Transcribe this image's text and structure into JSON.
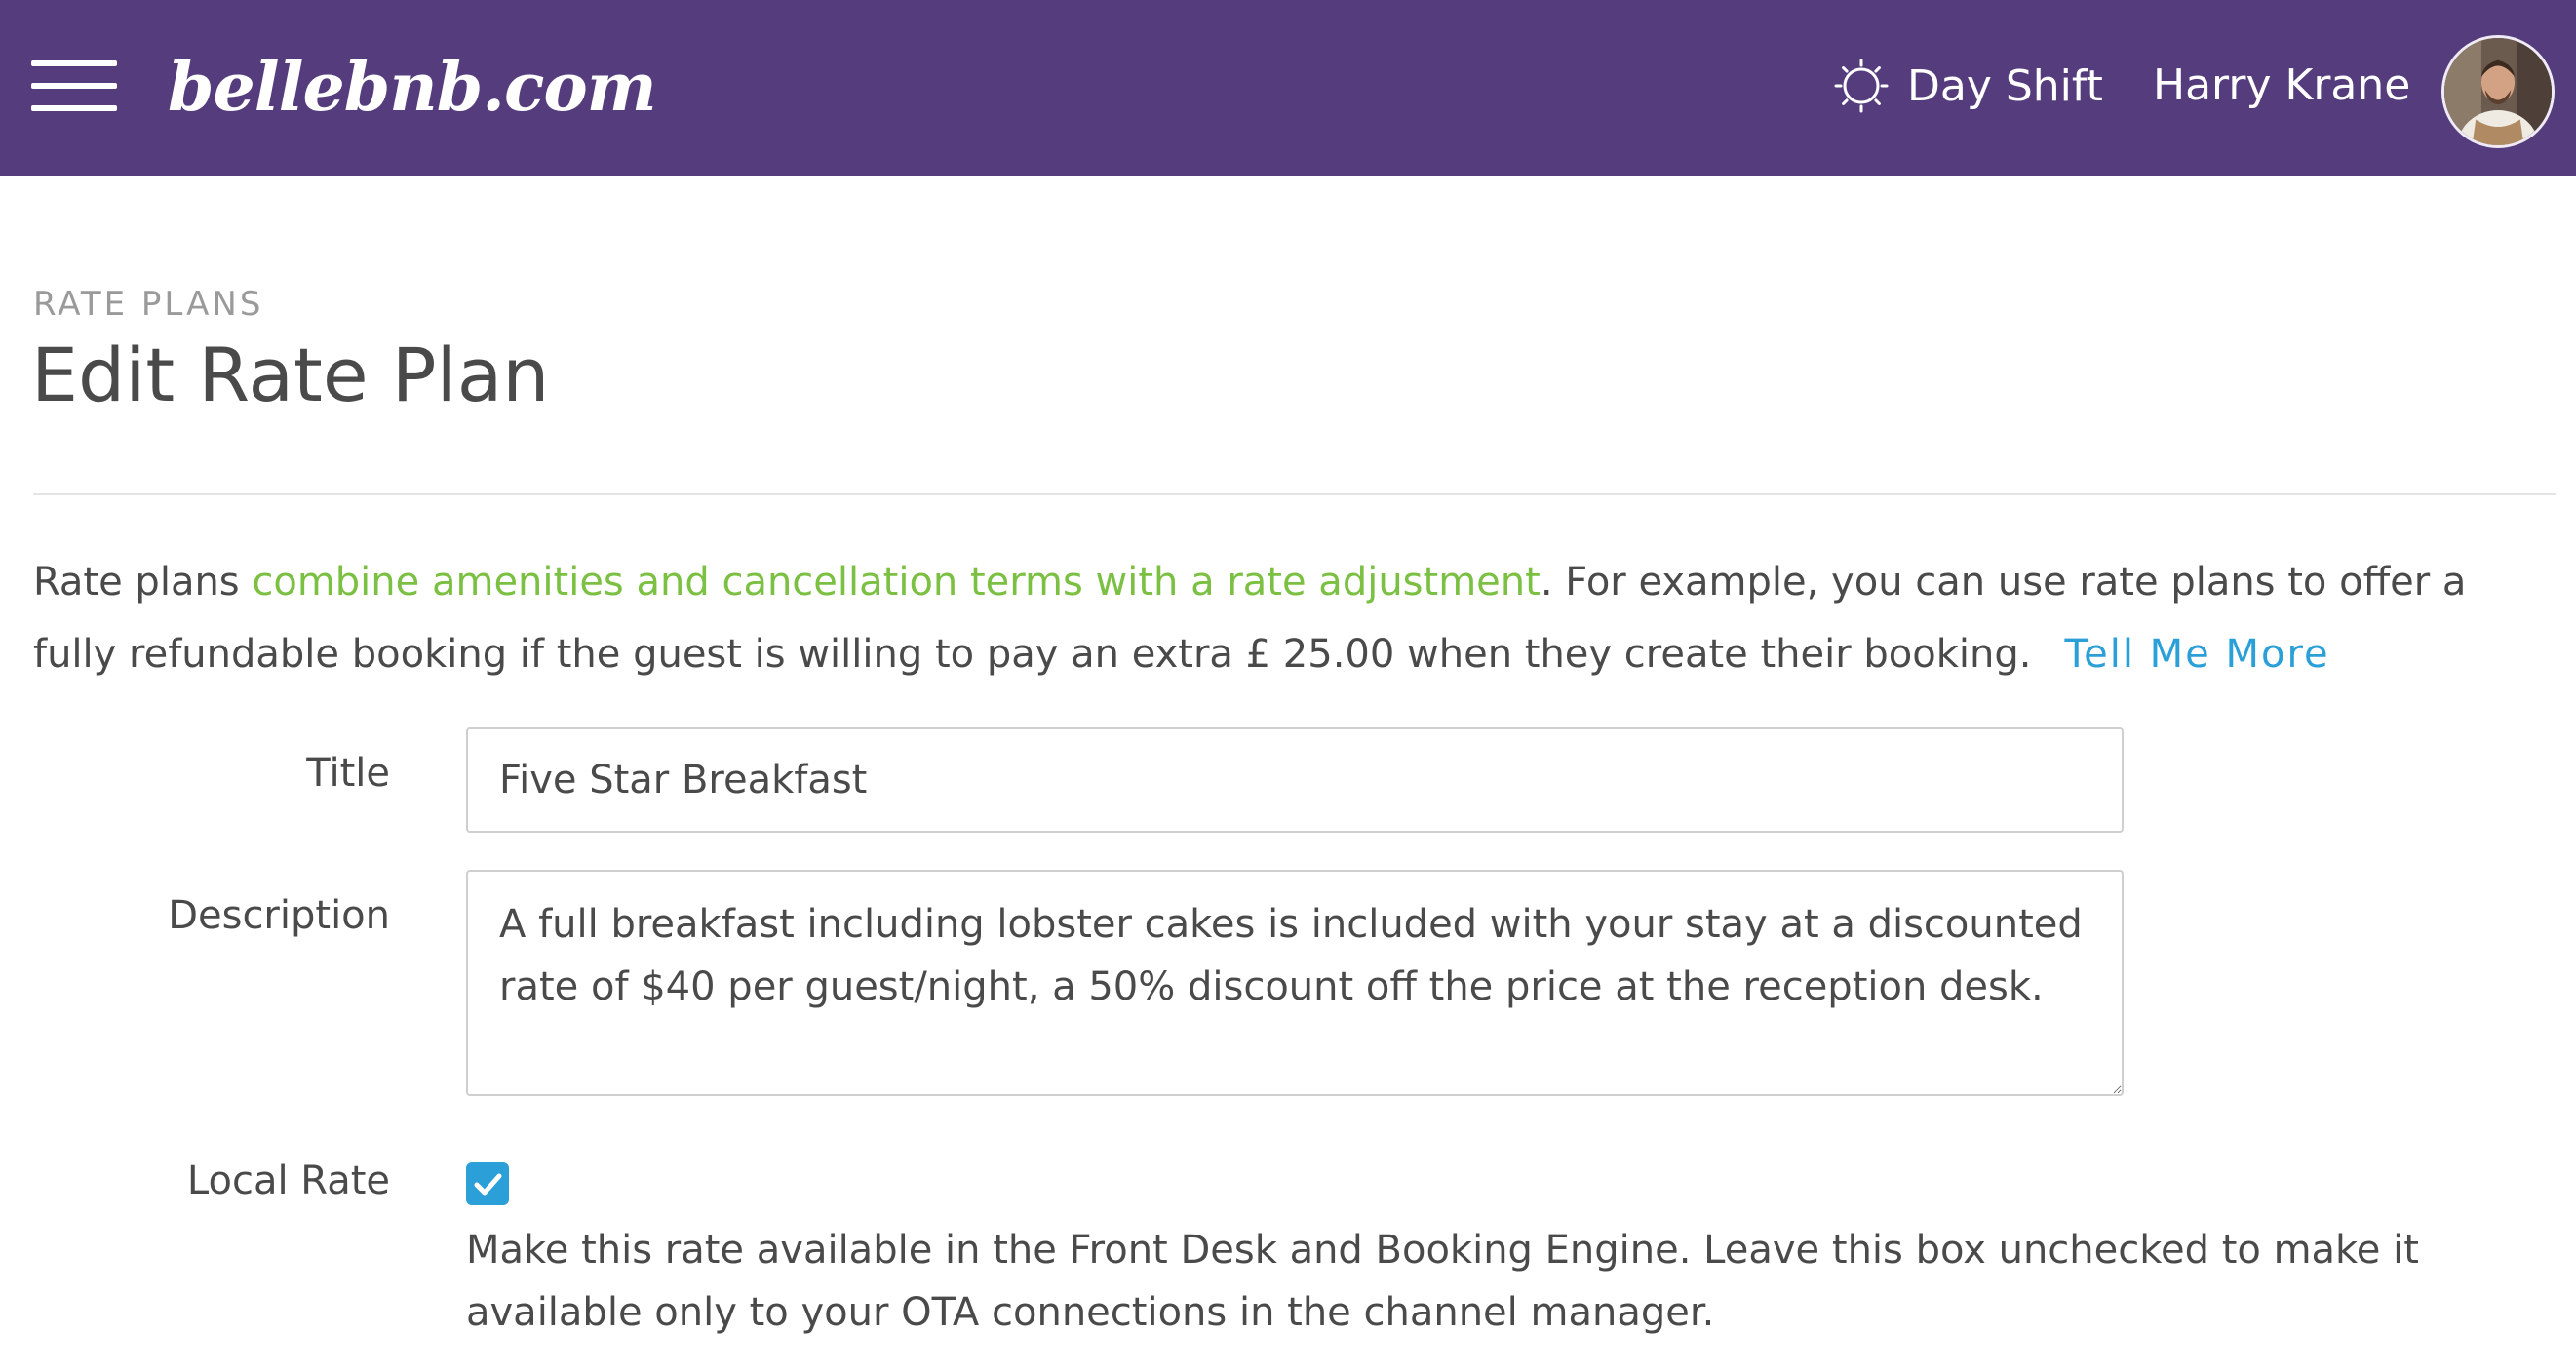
{
  "header": {
    "brand": "bellebnb.com",
    "shift_label": "Day Shift",
    "user_name": "Harry Krane"
  },
  "page": {
    "eyebrow": "RATE PLANS",
    "title": "Edit Rate Plan"
  },
  "intro": {
    "text_before": "Rate plans ",
    "highlight": "combine amenities and cancellation terms with a rate adjustment",
    "text_after": ". For example, you can use rate plans to offer a fully refundable booking if the guest is willing to pay an extra £ 25.00 when they create their booking.",
    "link_label": "Tell Me More"
  },
  "form": {
    "title_label": "Title",
    "title_value": "Five Star Breakfast",
    "description_label": "Description",
    "description_value": "A full breakfast including lobster cakes is included with your stay at a discounted rate of $40 per guest/night, a 50% discount off the price at the reception desk.",
    "local_rate_label": "Local Rate",
    "local_rate_checked": true,
    "local_rate_help": "Make this rate available in the Front Desk and Booking Engine. Leave this box unchecked to make it available only to your OTA connections in the channel manager."
  },
  "colors": {
    "header_bg": "#553d7d",
    "highlight": "#7bc043",
    "link": "#2a9fd8",
    "checkbox": "#2a9fd8"
  },
  "icons": {
    "menu": "hamburger-menu-icon",
    "shift": "sun-icon",
    "checkbox": "checkmark-icon"
  }
}
